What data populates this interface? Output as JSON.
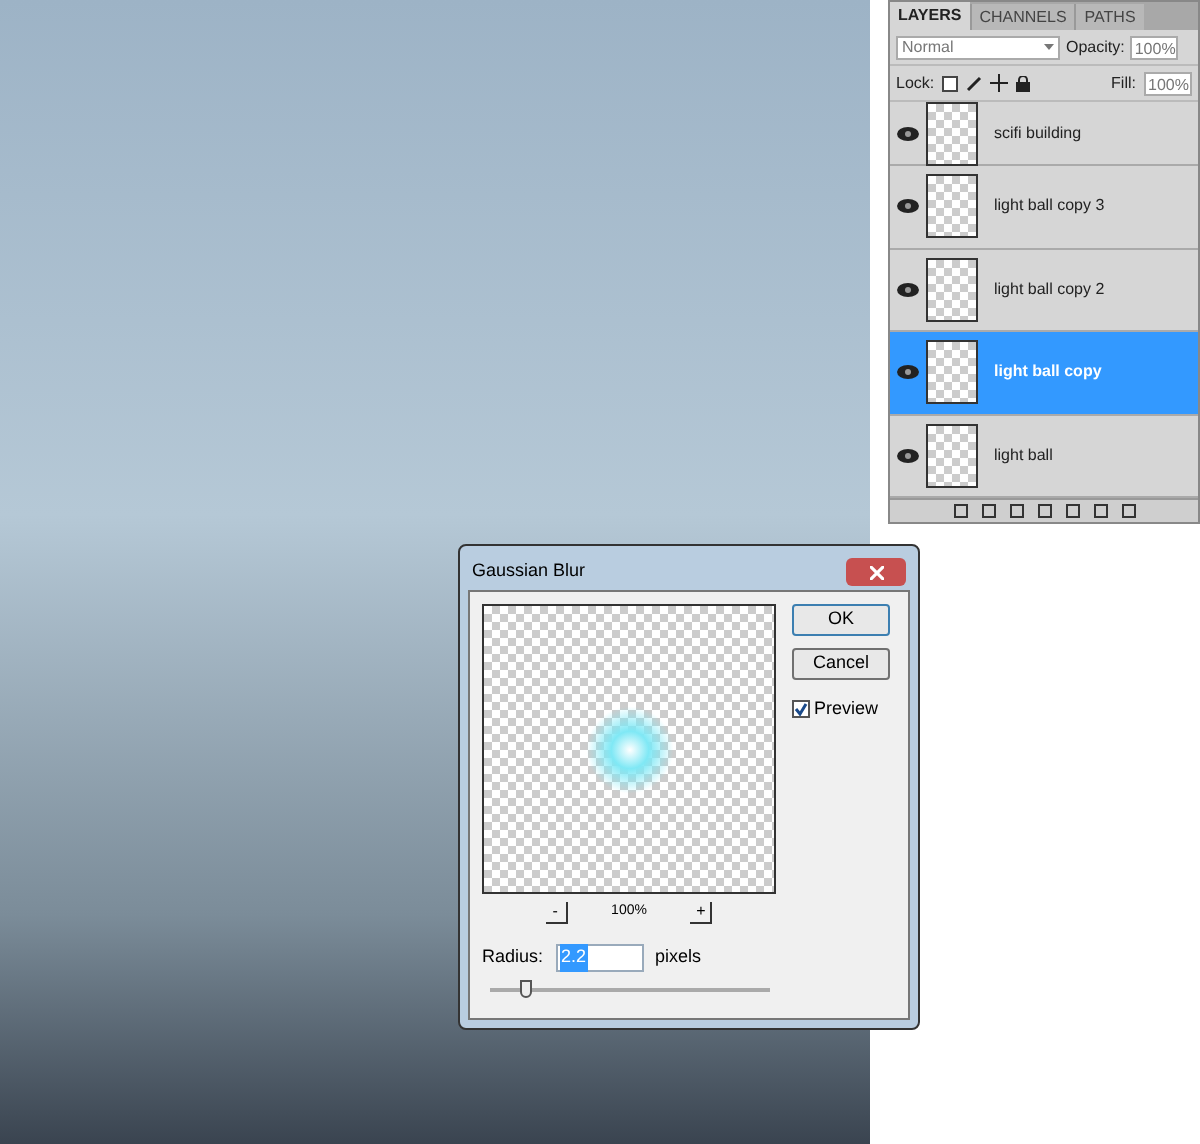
{
  "layers_panel": {
    "tabs": [
      {
        "label": "LAYERS",
        "selected": true
      },
      {
        "label": "CHANNELS",
        "selected": false
      },
      {
        "label": "PATHS",
        "selected": false
      }
    ],
    "blend_mode": "Normal",
    "opacity_label": "Opacity:",
    "opacity": "100%",
    "lock_label": "Lock:",
    "fill_label": "Fill:",
    "fill": "100%",
    "layers": [
      {
        "name": "scifi building",
        "visible": true,
        "selected": false
      },
      {
        "name": "light ball copy 3",
        "visible": true,
        "selected": false
      },
      {
        "name": "light ball copy 2",
        "visible": true,
        "selected": false
      },
      {
        "name": "light ball copy",
        "visible": true,
        "selected": true
      },
      {
        "name": "light ball",
        "visible": true,
        "selected": false
      }
    ]
  },
  "dialog": {
    "title": "Gaussian Blur",
    "zoom": "100%",
    "zoom_out": "-",
    "zoom_in": "+",
    "buttons": [
      "OK",
      "Cancel"
    ],
    "preview": {
      "label": "Preview",
      "checked": true
    },
    "radius_label": "Radius:",
    "radius": "2.2",
    "unit": "pixels",
    "radius_slider": {
      "level": 0.13
    }
  }
}
